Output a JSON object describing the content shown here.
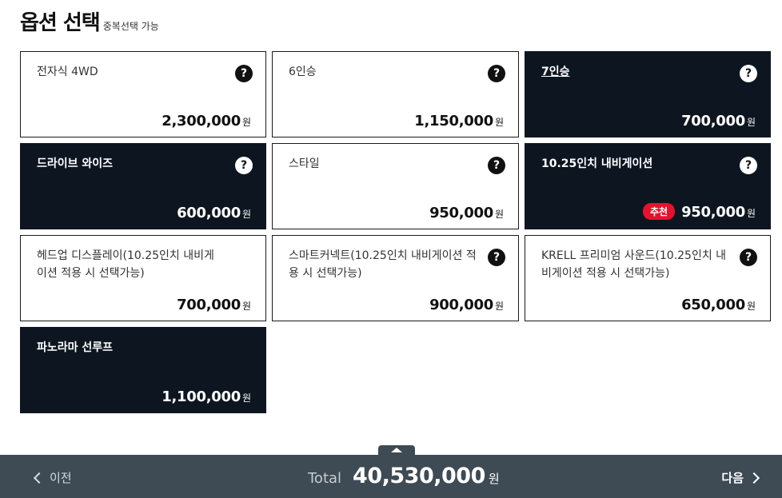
{
  "header": {
    "title": "옵션 선택",
    "subtitle": "중복선택 가능"
  },
  "help_label": "?",
  "currency": "원",
  "options": [
    {
      "name": "전자식 4WD",
      "price": "2,300,000",
      "selected": false,
      "help": true
    },
    {
      "name": "6인승",
      "price": "1,150,000",
      "selected": false,
      "help": true
    },
    {
      "name": "7인승",
      "price": "700,000",
      "selected": true,
      "help": true,
      "underline": true
    },
    {
      "name": "드라이브 와이즈",
      "price": "600,000",
      "selected": true,
      "help": true
    },
    {
      "name": "스타일",
      "price": "950,000",
      "selected": false,
      "help": true
    },
    {
      "name": "10.25인치 내비게이션",
      "price": "950,000",
      "selected": true,
      "help": true,
      "badge": "추천"
    },
    {
      "name": "헤드업 디스플레이(10.25인치 내비게이션 적용 시 선택가능)",
      "price": "700,000",
      "selected": false,
      "help": false
    },
    {
      "name": "스마트커넥트(10.25인치 내비게이션 적용 시 선택가능)",
      "price": "900,000",
      "selected": false,
      "help": true
    },
    {
      "name": "KRELL 프리미엄 사운드(10.25인치 내비게이션 적용 시 선택가능)",
      "price": "650,000",
      "selected": false,
      "help": true
    },
    {
      "name": "파노라마 선루프",
      "price": "1,100,000",
      "selected": true,
      "help": false
    }
  ],
  "footer": {
    "prev_label": "이전",
    "next_label": "다음",
    "total_label": "Total",
    "total_price": "40,530,000",
    "total_currency": "원"
  }
}
